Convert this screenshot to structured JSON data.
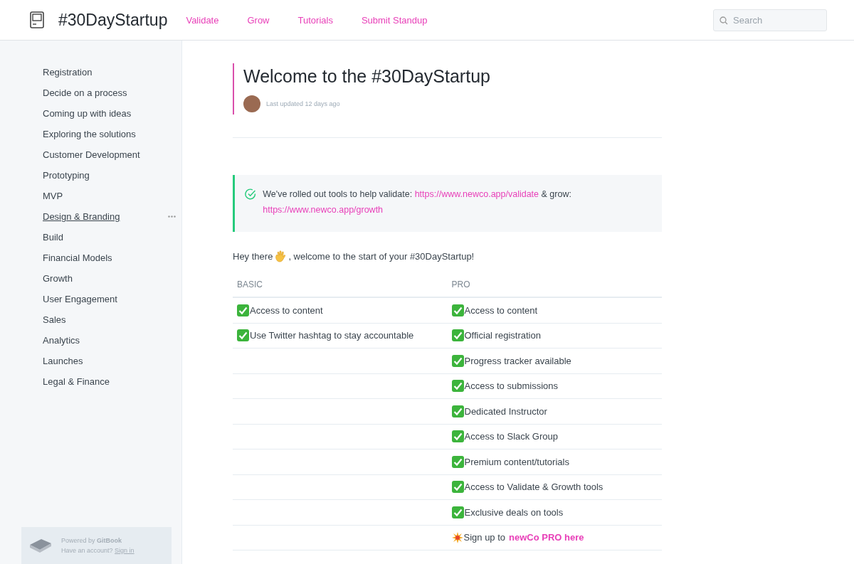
{
  "header": {
    "title": "#30DayStartup",
    "nav": [
      "Validate",
      "Grow",
      "Tutorials",
      "Submit Standup"
    ],
    "search": {
      "placeholder": "Search"
    }
  },
  "sidebar": {
    "items": [
      {
        "label": "Registration",
        "hovered": false
      },
      {
        "label": "Decide on a process",
        "hovered": false
      },
      {
        "label": "Coming up with ideas",
        "hovered": false
      },
      {
        "label": "Exploring the solutions",
        "hovered": false
      },
      {
        "label": "Customer Development",
        "hovered": false
      },
      {
        "label": "Prototyping",
        "hovered": false
      },
      {
        "label": "MVP",
        "hovered": false
      },
      {
        "label": "Design & Branding",
        "hovered": true
      },
      {
        "label": "Build",
        "hovered": false
      },
      {
        "label": "Financial Models",
        "hovered": false
      },
      {
        "label": "Growth",
        "hovered": false
      },
      {
        "label": "User Engagement",
        "hovered": false
      },
      {
        "label": "Sales",
        "hovered": false
      },
      {
        "label": "Analytics",
        "hovered": false
      },
      {
        "label": "Launches",
        "hovered": false
      },
      {
        "label": "Legal & Finance",
        "hovered": false
      }
    ],
    "footer": {
      "powered": "Powered by **GitBook**",
      "account": "Have an account?",
      "sign_in": "Sign in"
    }
  },
  "page": {
    "title": "Welcome to the #30DayStartup",
    "updated": "Last updated 12 days ago",
    "hint": {
      "text": "We've rolled out tools to help validate:",
      "link1": "https://www.newco.app/validate",
      "middle": "& grow:",
      "link2": "https://www.newco.app/growth"
    },
    "intro_before": "Hey there",
    "intro_after": ", welcome to the start of your #30DayStartup!",
    "table": {
      "columns": [
        "BASIC",
        "PRO"
      ],
      "rows": [
        [
          {
            "kind": "check",
            "text": "Access to content"
          },
          {
            "kind": "check",
            "text": "Access to content"
          }
        ],
        [
          {
            "kind": "check",
            "text": "Use Twitter hashtag to stay accountable"
          },
          {
            "kind": "check",
            "text": "Official registration"
          }
        ],
        [
          null,
          {
            "kind": "check",
            "text": "Progress tracker available"
          }
        ],
        [
          null,
          {
            "kind": "check",
            "text": "Access to submissions"
          }
        ],
        [
          null,
          {
            "kind": "check",
            "text": "Dedicated Instructor"
          }
        ],
        [
          null,
          {
            "kind": "check",
            "text": "Access to Slack Group"
          }
        ],
        [
          null,
          {
            "kind": "check",
            "text": "Premium content/tutorials"
          }
        ],
        [
          null,
          {
            "kind": "check",
            "text": "Access to Validate & Growth tools"
          }
        ],
        [
          null,
          {
            "kind": "check",
            "text": "Exclusive deals on tools"
          }
        ],
        [
          null,
          {
            "kind": "burst",
            "text": "Sign up to",
            "link": "newCo PRO here"
          }
        ]
      ]
    }
  }
}
